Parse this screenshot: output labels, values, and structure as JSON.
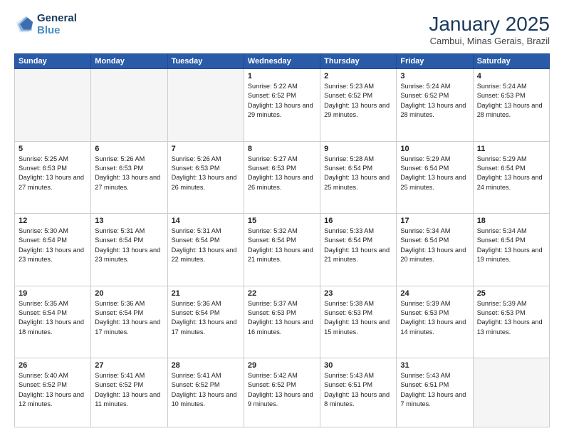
{
  "logo": {
    "line1": "General",
    "line2": "Blue"
  },
  "title": "January 2025",
  "subtitle": "Cambui, Minas Gerais, Brazil",
  "days_of_week": [
    "Sunday",
    "Monday",
    "Tuesday",
    "Wednesday",
    "Thursday",
    "Friday",
    "Saturday"
  ],
  "weeks": [
    [
      {
        "day": "",
        "info": ""
      },
      {
        "day": "",
        "info": ""
      },
      {
        "day": "",
        "info": ""
      },
      {
        "day": "1",
        "info": "Sunrise: 5:22 AM\nSunset: 6:52 PM\nDaylight: 13 hours and 29 minutes."
      },
      {
        "day": "2",
        "info": "Sunrise: 5:23 AM\nSunset: 6:52 PM\nDaylight: 13 hours and 29 minutes."
      },
      {
        "day": "3",
        "info": "Sunrise: 5:24 AM\nSunset: 6:52 PM\nDaylight: 13 hours and 28 minutes."
      },
      {
        "day": "4",
        "info": "Sunrise: 5:24 AM\nSunset: 6:53 PM\nDaylight: 13 hours and 28 minutes."
      }
    ],
    [
      {
        "day": "5",
        "info": "Sunrise: 5:25 AM\nSunset: 6:53 PM\nDaylight: 13 hours and 27 minutes."
      },
      {
        "day": "6",
        "info": "Sunrise: 5:26 AM\nSunset: 6:53 PM\nDaylight: 13 hours and 27 minutes."
      },
      {
        "day": "7",
        "info": "Sunrise: 5:26 AM\nSunset: 6:53 PM\nDaylight: 13 hours and 26 minutes."
      },
      {
        "day": "8",
        "info": "Sunrise: 5:27 AM\nSunset: 6:53 PM\nDaylight: 13 hours and 26 minutes."
      },
      {
        "day": "9",
        "info": "Sunrise: 5:28 AM\nSunset: 6:54 PM\nDaylight: 13 hours and 25 minutes."
      },
      {
        "day": "10",
        "info": "Sunrise: 5:29 AM\nSunset: 6:54 PM\nDaylight: 13 hours and 25 minutes."
      },
      {
        "day": "11",
        "info": "Sunrise: 5:29 AM\nSunset: 6:54 PM\nDaylight: 13 hours and 24 minutes."
      }
    ],
    [
      {
        "day": "12",
        "info": "Sunrise: 5:30 AM\nSunset: 6:54 PM\nDaylight: 13 hours and 23 minutes."
      },
      {
        "day": "13",
        "info": "Sunrise: 5:31 AM\nSunset: 6:54 PM\nDaylight: 13 hours and 23 minutes."
      },
      {
        "day": "14",
        "info": "Sunrise: 5:31 AM\nSunset: 6:54 PM\nDaylight: 13 hours and 22 minutes."
      },
      {
        "day": "15",
        "info": "Sunrise: 5:32 AM\nSunset: 6:54 PM\nDaylight: 13 hours and 21 minutes."
      },
      {
        "day": "16",
        "info": "Sunrise: 5:33 AM\nSunset: 6:54 PM\nDaylight: 13 hours and 21 minutes."
      },
      {
        "day": "17",
        "info": "Sunrise: 5:34 AM\nSunset: 6:54 PM\nDaylight: 13 hours and 20 minutes."
      },
      {
        "day": "18",
        "info": "Sunrise: 5:34 AM\nSunset: 6:54 PM\nDaylight: 13 hours and 19 minutes."
      }
    ],
    [
      {
        "day": "19",
        "info": "Sunrise: 5:35 AM\nSunset: 6:54 PM\nDaylight: 13 hours and 18 minutes."
      },
      {
        "day": "20",
        "info": "Sunrise: 5:36 AM\nSunset: 6:54 PM\nDaylight: 13 hours and 17 minutes."
      },
      {
        "day": "21",
        "info": "Sunrise: 5:36 AM\nSunset: 6:54 PM\nDaylight: 13 hours and 17 minutes."
      },
      {
        "day": "22",
        "info": "Sunrise: 5:37 AM\nSunset: 6:53 PM\nDaylight: 13 hours and 16 minutes."
      },
      {
        "day": "23",
        "info": "Sunrise: 5:38 AM\nSunset: 6:53 PM\nDaylight: 13 hours and 15 minutes."
      },
      {
        "day": "24",
        "info": "Sunrise: 5:39 AM\nSunset: 6:53 PM\nDaylight: 13 hours and 14 minutes."
      },
      {
        "day": "25",
        "info": "Sunrise: 5:39 AM\nSunset: 6:53 PM\nDaylight: 13 hours and 13 minutes."
      }
    ],
    [
      {
        "day": "26",
        "info": "Sunrise: 5:40 AM\nSunset: 6:52 PM\nDaylight: 13 hours and 12 minutes."
      },
      {
        "day": "27",
        "info": "Sunrise: 5:41 AM\nSunset: 6:52 PM\nDaylight: 13 hours and 11 minutes."
      },
      {
        "day": "28",
        "info": "Sunrise: 5:41 AM\nSunset: 6:52 PM\nDaylight: 13 hours and 10 minutes."
      },
      {
        "day": "29",
        "info": "Sunrise: 5:42 AM\nSunset: 6:52 PM\nDaylight: 13 hours and 9 minutes."
      },
      {
        "day": "30",
        "info": "Sunrise: 5:43 AM\nSunset: 6:51 PM\nDaylight: 13 hours and 8 minutes."
      },
      {
        "day": "31",
        "info": "Sunrise: 5:43 AM\nSunset: 6:51 PM\nDaylight: 13 hours and 7 minutes."
      },
      {
        "day": "",
        "info": ""
      }
    ]
  ]
}
